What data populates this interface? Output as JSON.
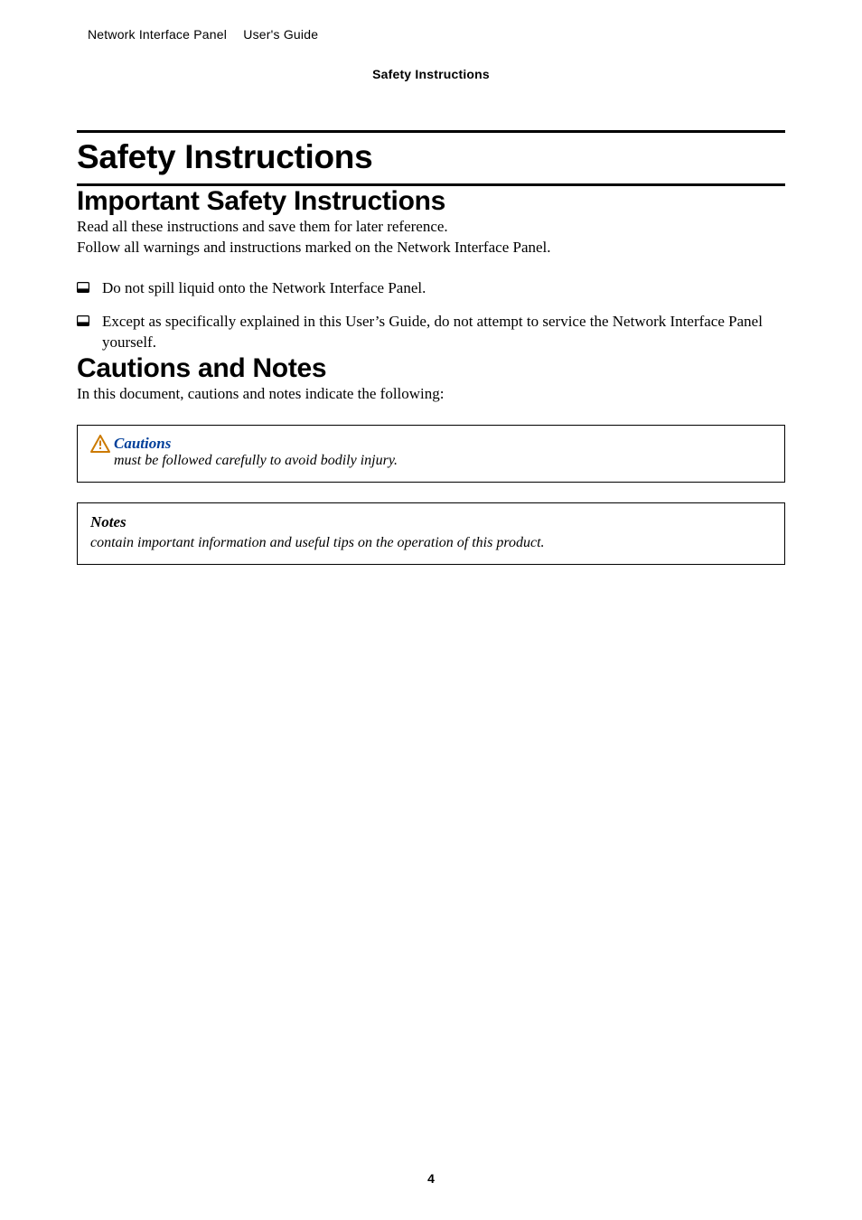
{
  "header": {
    "doc_title": "Network Interface Panel  User's Guide",
    "section": "Safety Instructions"
  },
  "title": "Safety Instructions",
  "sections": {
    "important": {
      "heading": "Important Safety Instructions",
      "p1": "Read all these instructions and save them for later reference.",
      "p2": "Follow all warnings and instructions marked on the Network Interface Panel.",
      "bullets": [
        "Do not spill liquid onto the Network Interface Panel.",
        "Except as specifically explained in this User’s Guide, do not attempt to service the Network Interface Panel yourself."
      ]
    },
    "cautions_notes": {
      "heading": "Cautions and Notes",
      "intro": "In this document, cautions and notes indicate the following:",
      "caution": {
        "label": "Cautions",
        "body": "must be followed carefully to avoid bodily injury."
      },
      "note": {
        "label": "Notes",
        "body": "contain important information and useful tips on the operation of this product."
      }
    }
  },
  "page_number": "4",
  "colors": {
    "caution_label": "#003f9a"
  },
  "icons": {
    "bullet": "notebook-bullet-icon",
    "warning": "warning-triangle-icon"
  }
}
